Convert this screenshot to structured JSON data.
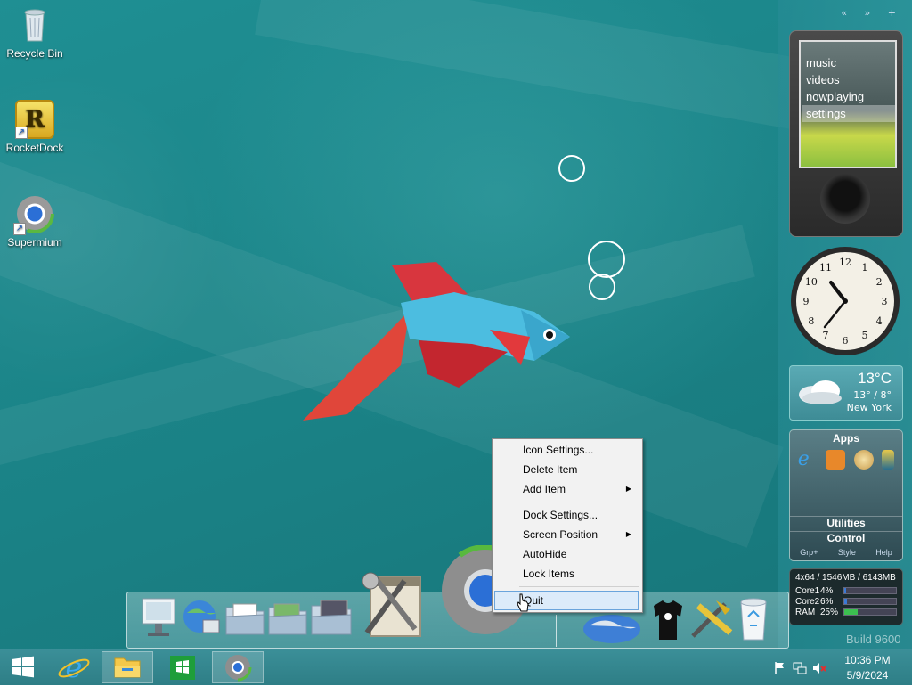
{
  "desktop": {
    "icons": [
      {
        "label": "Recycle Bin",
        "icon": "recycle-bin-icon"
      },
      {
        "label": "RocketDock",
        "icon": "rocketdock-icon",
        "glyph": "R"
      },
      {
        "label": "Supermium",
        "icon": "supermium-icon"
      }
    ],
    "build_watermark": "Build 9600"
  },
  "sidebar": {
    "controls": "« » +",
    "zune": {
      "menu": [
        "music",
        "videos",
        "nowplaying",
        "settings"
      ],
      "selected": "settings"
    },
    "clock": {
      "numbers": [
        "12",
        "1",
        "2",
        "3",
        "4",
        "5",
        "6",
        "7",
        "8",
        "9",
        "10",
        "11"
      ]
    },
    "weather": {
      "temp": "13°C",
      "high_low": "13° / 8°",
      "city": "New York"
    },
    "apps": {
      "title": "Apps",
      "rows": [
        "Utilities",
        "Control"
      ],
      "footer": [
        "Grp+",
        "Style",
        "Help"
      ]
    },
    "cpu": {
      "header": "4x64 / 1546MB / 6143MB",
      "rows": [
        {
          "name": "Core1",
          "value": "4%",
          "level": 0.04
        },
        {
          "name": "Core2",
          "value": "6%",
          "level": 0.06
        },
        {
          "name": "RAM",
          "value": "25%",
          "level": 0.25
        }
      ]
    }
  },
  "context_menu": {
    "items": [
      {
        "label": "Icon Settings...",
        "submenu": false
      },
      {
        "label": "Delete Item",
        "submenu": false
      },
      {
        "label": "Add Item",
        "submenu": true
      },
      {
        "label": "Dock Settings...",
        "submenu": false
      },
      {
        "label": "Screen Position",
        "submenu": true
      },
      {
        "label": "AutoHide",
        "submenu": false
      },
      {
        "label": "Lock Items",
        "submenu": false
      },
      {
        "label": "Quit",
        "submenu": false,
        "highlighted": true
      }
    ],
    "submenu_arrow": "▶"
  },
  "dock": {
    "items": [
      "computer-icon",
      "network-globe-icon",
      "documents-folder-icon",
      "pictures-folder-icon",
      "videos-folder-icon",
      "tools-icon",
      "supermium-icon",
      "earth-icon",
      "tshirt-icon",
      "settings-tools-icon",
      "recycle-bin-icon"
    ]
  },
  "taskbar": {
    "buttons": [
      "start-button",
      "internet-explorer",
      "file-explorer",
      "windows-store",
      "supermium"
    ],
    "active": "file-explorer",
    "time": "10:36 PM",
    "date": "5/9/2024"
  }
}
